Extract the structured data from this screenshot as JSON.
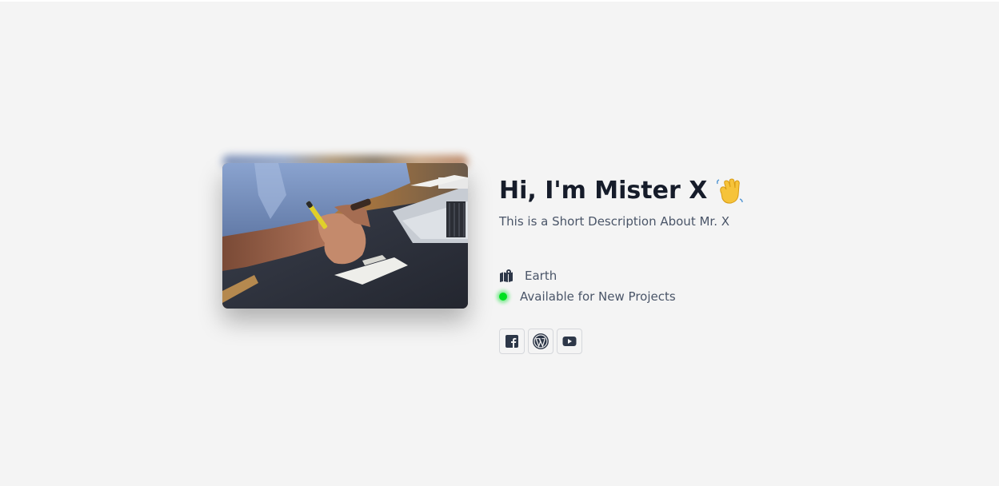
{
  "profile": {
    "heading": "Hi, I'm Mister X",
    "description": "This is a Short Description About Mr. X",
    "location": "Earth",
    "availability": "Available for New Projects",
    "status_color": "#00e020"
  },
  "photo": {
    "alt": "Person writing on paper next to a laptop"
  },
  "socials": [
    {
      "icon": "facebook-icon",
      "label": "Facebook"
    },
    {
      "icon": "wordpress-icon",
      "label": "WordPress"
    },
    {
      "icon": "youtube-icon",
      "label": "YouTube"
    }
  ],
  "colors": {
    "background": "#f4f4f4",
    "heading": "#161c2a",
    "text": "#4a5568",
    "icon": "#2d3748"
  }
}
